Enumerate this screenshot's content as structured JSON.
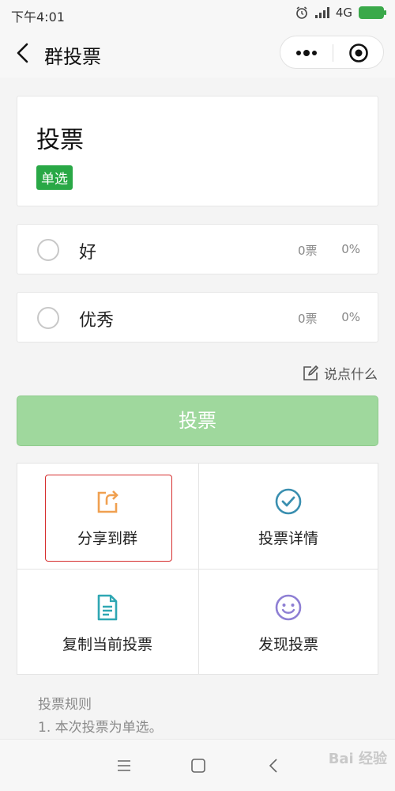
{
  "status_bar": {
    "time": "下午4:01",
    "network": "4G"
  },
  "nav": {
    "title": "群投票"
  },
  "poll": {
    "title": "投票",
    "type_tag": "单选"
  },
  "options": [
    {
      "label": "好",
      "votes": "0票",
      "percent": "0%"
    },
    {
      "label": "优秀",
      "votes": "0票",
      "percent": "0%"
    }
  ],
  "comment": {
    "label": "说点什么"
  },
  "vote_button": {
    "label": "投票"
  },
  "actions": [
    {
      "label": "分享到群",
      "icon": "share-icon",
      "color": "#f0a050"
    },
    {
      "label": "投票详情",
      "icon": "check-circle-icon",
      "color": "#3a8fb0"
    },
    {
      "label": "复制当前投票",
      "icon": "document-icon",
      "color": "#2fa7b3"
    },
    {
      "label": "发现投票",
      "icon": "smile-icon",
      "color": "#8e7fd4"
    }
  ],
  "rules": {
    "title": "投票规则",
    "item1": "1. 本次投票为单选。"
  },
  "watermark": "Bai 经验"
}
